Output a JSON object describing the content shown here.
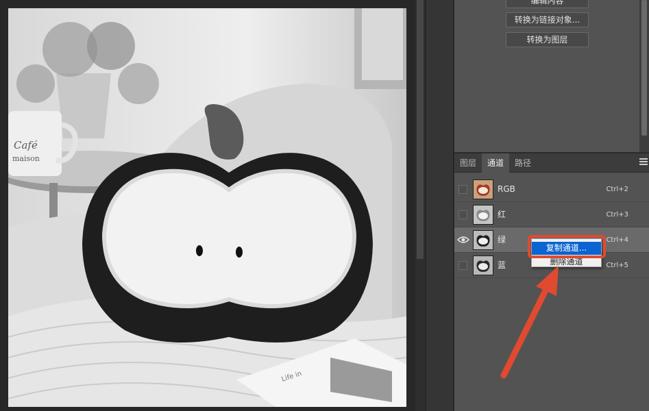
{
  "properties": {
    "buttons": [
      "编辑内容",
      "转换为链接对象...",
      "转换为图层"
    ]
  },
  "channels_panel": {
    "tabs": [
      "图层",
      "通道",
      "路径"
    ],
    "active_tab": "通道",
    "rows": [
      {
        "name": "RGB",
        "shortcut": "Ctrl+2",
        "visible": false,
        "active": false
      },
      {
        "name": "红",
        "shortcut": "Ctrl+3",
        "visible": false,
        "active": false
      },
      {
        "name": "绿",
        "shortcut": "Ctrl+4",
        "visible": true,
        "active": true
      },
      {
        "name": "蓝",
        "shortcut": "Ctrl+5",
        "visible": false,
        "active": false
      }
    ]
  },
  "context_menu": {
    "items": [
      "复制通道...",
      "删除通道"
    ],
    "highlighted": "复制通道..."
  },
  "colors": {
    "accent": "#0a64d2",
    "annotation": "#e04a30"
  },
  "canvas": {
    "image_texts": [
      "Café",
      "maison",
      "Life in"
    ]
  }
}
